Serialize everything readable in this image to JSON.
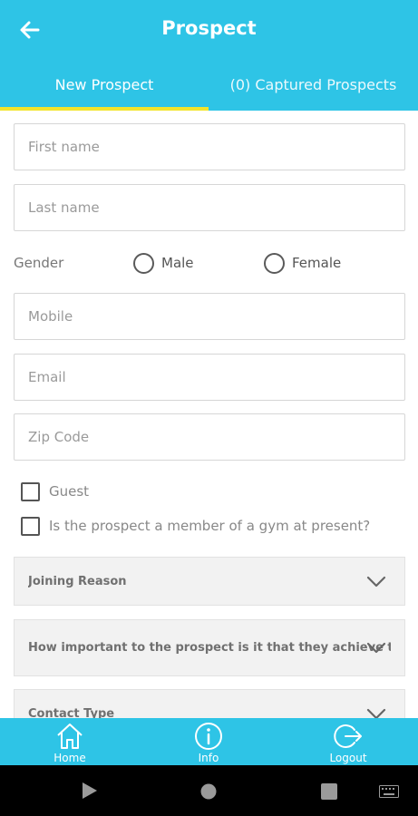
{
  "header": {
    "title": "Prospect"
  },
  "tabs": [
    {
      "label": "New Prospect",
      "active": true
    },
    {
      "label": "(0) Captured Prospects",
      "active": false
    }
  ],
  "form": {
    "first_name": {
      "placeholder": "First name",
      "value": ""
    },
    "last_name": {
      "placeholder": "Last name",
      "value": ""
    },
    "gender": {
      "label": "Gender",
      "options": [
        "Male",
        "Female"
      ],
      "selected": null
    },
    "mobile": {
      "placeholder": "Mobile",
      "value": ""
    },
    "email": {
      "placeholder": "Email",
      "value": ""
    },
    "zip": {
      "placeholder": "Zip Code",
      "value": ""
    },
    "guest": {
      "label": "Guest",
      "checked": false
    },
    "gym_member": {
      "label": "Is the prospect a member of a gym at present?",
      "checked": false
    },
    "joining_reason": {
      "label": "Joining Reason"
    },
    "importance": {
      "label": "How important to the prospect is it that they achieve the..."
    },
    "contact_type": {
      "label": "Contact Type"
    }
  },
  "bottom_nav": [
    {
      "label": "Home",
      "icon": "home-icon"
    },
    {
      "label": "Info",
      "icon": "info-icon"
    },
    {
      "label": "Logout",
      "icon": "logout-icon"
    }
  ],
  "colors": {
    "primary": "#2ec4e6",
    "tab_indicator": "#f2e42a",
    "field_border": "#d6d6d6",
    "dropdown_bg": "#f2f2f2"
  }
}
